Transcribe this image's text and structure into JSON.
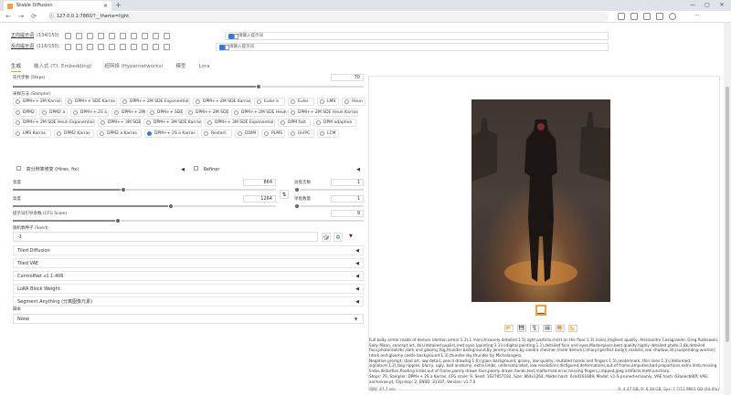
{
  "browser": {
    "tab_title": "Stable Diffusion",
    "url": "127.0.0.1:7860/?__theme=light",
    "new_tab": "+",
    "tab_close": "×",
    "win_min": "—",
    "win_max": "▢",
    "win_close": "✕",
    "nav_back": "←",
    "nav_forward": "→",
    "nav_reload": "⟳",
    "info_icon": "ⓘ"
  },
  "prompts": {
    "positive": {
      "label": "正向提示词",
      "count": "(134/150)",
      "box_text": "请输入提示词"
    },
    "negative": {
      "label": "反向提示词",
      "count": "(116/150)",
      "box_text": "请输入提示词"
    }
  },
  "main_tabs": [
    "生成",
    "嵌入式 (T.I. Embedding)",
    "超网络 (Hypernetworks)",
    "模型",
    "Lora"
  ],
  "steps": {
    "label": "迭代步数 (Steps)",
    "value": "70",
    "fraction": 0.7
  },
  "sampler": {
    "label": "采样方法 (Sampler)",
    "selected": "DPM++ 2S a Karras",
    "options": [
      [
        "DPM++ 2M Karras",
        "DPM++ SDE Karras",
        "DPM++ 2M SDE Exponential",
        "DPM++ 2M SDE Karras",
        "Euler a",
        "Euler",
        "LMS",
        "Heun"
      ],
      [
        "DPM2",
        "DPM2 a",
        "DPM++ 2S a",
        "DPM++ 2M",
        "DPM++ SDE",
        "DPM++ 2M SDE",
        "DPM++ 2M SDE Heun",
        "DPM++ 2M SDE Heun Karras"
      ],
      [
        "DPM++ 2M SDE Heun Exponential",
        "DPM++ 3M SDE",
        "DPM++ 3M SDE Karras",
        "DPM++ 3M SDE Exponential",
        "DPM fast",
        "DPM adaptive"
      ],
      [
        "LMS Karras",
        "DPM2 Karras",
        "DPM2 a Karras",
        "DPM++ 2S a Karras",
        "Restart",
        "DDIM",
        "PLMS",
        "UniPC",
        "LCM"
      ]
    ]
  },
  "hires": {
    "label": "高分辨率修复 (Hires. fix)",
    "arrow": "◀"
  },
  "refiner": {
    "label": "Refiner",
    "arrow": "◀"
  },
  "width": {
    "label": "宽度",
    "value": "864",
    "fraction": 0.42
  },
  "height": {
    "label": "高度",
    "value": "1264",
    "fraction": 0.6
  },
  "swap_icon": "⇅",
  "batch_count": {
    "label": "总批次数",
    "value": "1"
  },
  "batch_size": {
    "label": "单批数量",
    "value": "1"
  },
  "cfg": {
    "label": "提示词引导系数 (CFG Scale)",
    "value": "9",
    "fraction": 0.3
  },
  "seed": {
    "label": "随机数种子 (Seed)",
    "value": "-1",
    "dice": "🎲",
    "recycle": "♻",
    "arrow": "▼"
  },
  "panels": [
    "Tiled Diffusion",
    "Tiled VAE",
    "ControlNet v1.1.406",
    "LoRA Block Weight",
    "Segment Anything (分离图像元素)"
  ],
  "panel_arrow": "◀",
  "script": {
    "label": "脚本",
    "value": "None",
    "arrow": "▼"
  },
  "output": {
    "actions": [
      "📂",
      "💾",
      "🗜",
      "🖼",
      "🎨",
      "📐"
    ],
    "info": [
      "Full body armor made of demon (demon armor:1.3),1 man,(Insanely detailed:1.5),light particle,(mist on the floor:1.3),(solo),(highest quality, Alessandro Casagrande, Greg Rutkowski, Sally Mann, concept art, 4k),(detailed pupils),(red eyes,(painting:1.1)),(digital painting:1.1),detailed face and eyes,Masterpiece,best quality,highly detailed photo:1,8k,detailed face,photorealistic,dark and gloomy,fog,thunder background,By Jeremy mann,by sandra chevrier,(male demon),(sharp:(perfect body)),realistic,real shadow,3d,(suspending warrior),(dark and gloomy castle background:1.3),thunder sky,thunder by Michelangelo,",
      "Negative prompt: (bad art, low detail, pencil drawing:1.6),(plain background, grainy, low quality, mutated hands and fingers:1.5),(watermark, thin lines:1.3),(deformed, signature:1.2),(big nipples, blurry, ugly, bad anatomy, extra limbs, undersaturated, low resolution),disfigured,deformations,out of frame,amputee,bad proportions,extra limb,missing limbs,distortion,floating limbs,out of frame,poorly drawn face,poorly drawn hands,text,malformed,error,missing fingers,cropped,jpeg artifacts,teeth,unsharp,",
      "Steps: 70, Sampler: DPM++ 2S a Karras, CFG scale: 9, Seed: 1627857192, Size: 864x1264, Model hash: 6ce0161689, Model: v1-5-pruned-emaonly, VAE hash: 63aeecb90f, VAE: animevae.pt, Clip skip: 2, ENSD: 31337, Version: v1.7.0"
    ],
    "time_label": "用时: 47.7 sec.",
    "vram": "A: 4.47 GB, R: 6.38 GB, Sys: 7.7/11.9961 GB (64.0%)"
  }
}
